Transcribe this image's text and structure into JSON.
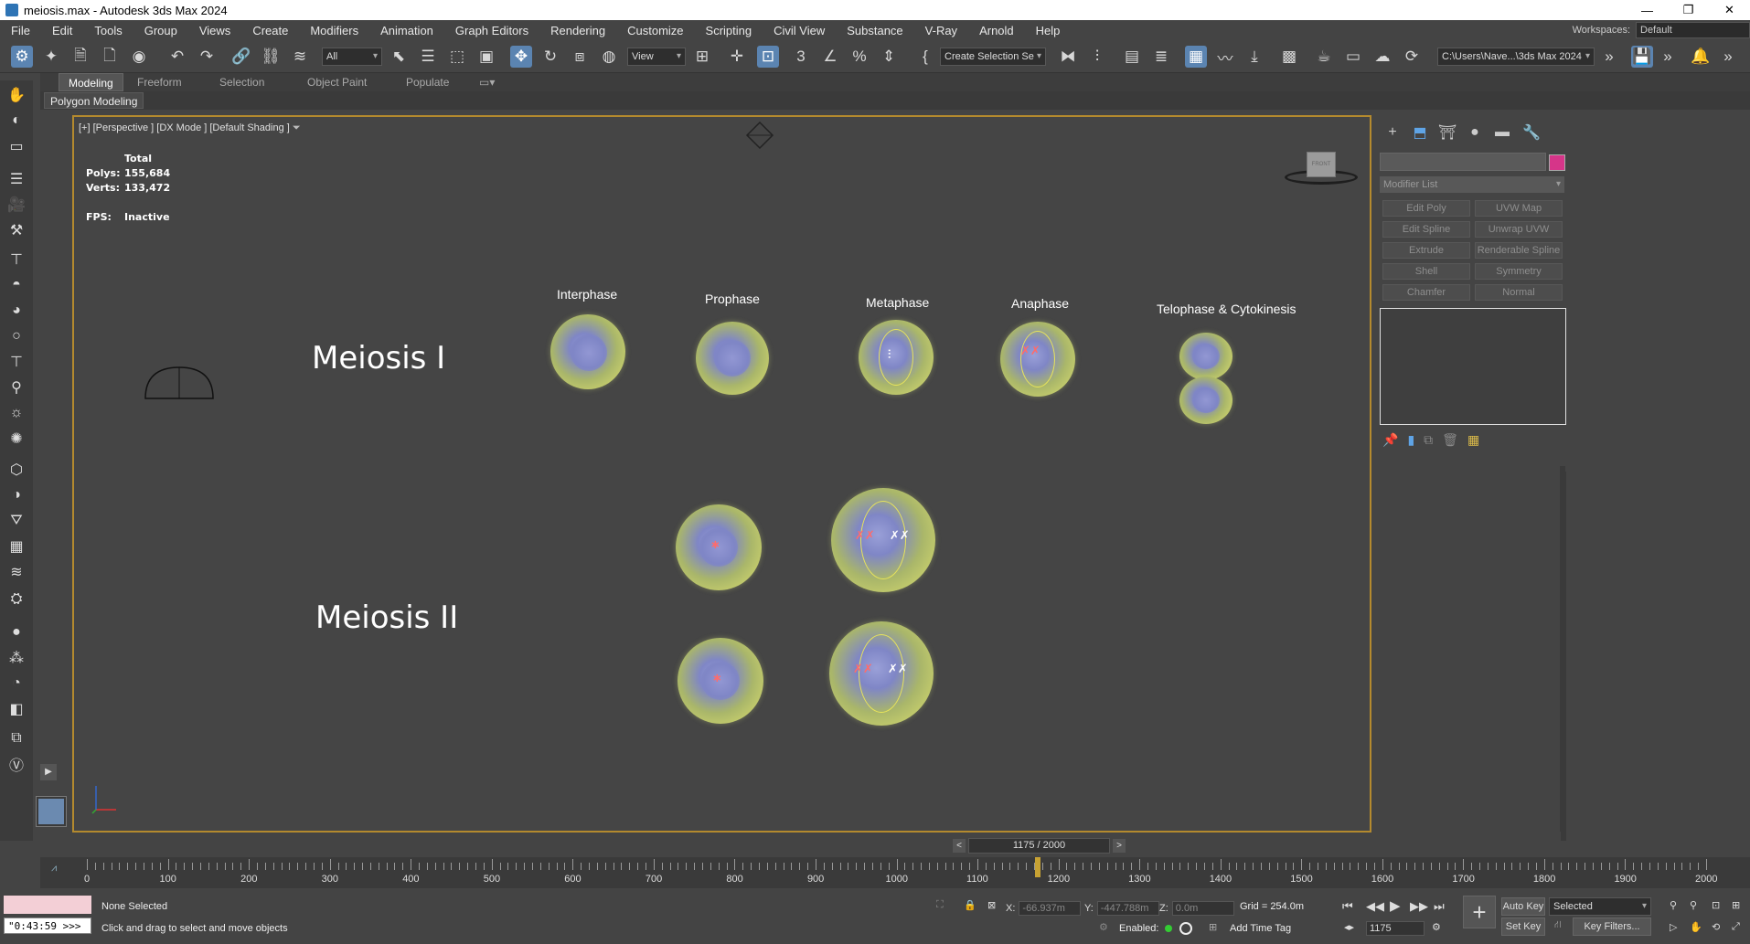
{
  "window": {
    "title": "meiosis.max - Autodesk 3ds Max 2024",
    "controls": [
      "—",
      "❐",
      "✕"
    ]
  },
  "menu": {
    "items": [
      "File",
      "Edit",
      "Tools",
      "Group",
      "Views",
      "Create",
      "Modifiers",
      "Animation",
      "Graph Editors",
      "Rendering",
      "Customize",
      "Scripting",
      "Civil View",
      "Substance",
      "V-Ray",
      "Arnold",
      "Help"
    ],
    "workspaces_label": "Workspaces:",
    "workspace_value": "Default"
  },
  "toolbar": {
    "filter_value": "All",
    "view_value": "View",
    "selection_set_value": "Create Selection Se",
    "path_value": "C:\\Users\\Nave...\\3ds Max 2024"
  },
  "ribbon": {
    "tabs": [
      "Modeling",
      "Freeform",
      "Selection",
      "Object Paint",
      "Populate"
    ],
    "active_tab": "Modeling",
    "panel_label": "Polygon Modeling"
  },
  "viewport": {
    "label": "[+] [Perspective ] [DX Mode ] [Default Shading ]",
    "stats": {
      "total_label": "Total",
      "polys_label": "Polys:",
      "polys_value": "155,684",
      "verts_label": "Verts:",
      "verts_value": "133,472",
      "fps_label": "FPS:",
      "fps_value": "Inactive"
    },
    "viewcube_label": "FRONT",
    "meiosis1_label": "Meiosis I",
    "meiosis2_label": "Meiosis II",
    "phases": [
      "Interphase",
      "Prophase",
      "Metaphase",
      "Anaphase",
      "Telophase & Cytokinesis"
    ]
  },
  "command_panel": {
    "modifier_list": "Modifier List",
    "buttons": [
      "Edit Poly",
      "UVW Map",
      "Edit Spline",
      "Unwrap UVW",
      "Extrude",
      "Renderable Spline",
      "Shell",
      "Symmetry",
      "Chamfer",
      "Normal"
    ],
    "color_swatch": "#d63589"
  },
  "timeslider": {
    "value": "1175 / 2000",
    "prev": "<",
    "next": ">"
  },
  "timeline": {
    "ticks": [
      "0",
      "100",
      "200",
      "300",
      "400",
      "500",
      "600",
      "700",
      "800",
      "900",
      "1000",
      "1100",
      "1200",
      "1300",
      "1400",
      "1500",
      "1600",
      "1700",
      "1800",
      "1900",
      "2000"
    ],
    "current_frame": 1175,
    "max_frame": 2000
  },
  "status": {
    "selection": "None Selected",
    "prompt": "Click and drag to select and move objects",
    "clock": "\"0:43:59 >>>",
    "x_label": "X:",
    "x_value": "-66.937m",
    "y_label": "Y:",
    "y_value": "-447.788m",
    "z_label": "Z:",
    "z_value": "0.0m",
    "grid": "Grid = 254.0m",
    "enabled_label": "Enabled:",
    "add_time_tag": "Add Time Tag",
    "frame_value": "1175",
    "auto_key": "Auto Key",
    "set_key": "Set Key",
    "selected_value": "Selected",
    "key_filters": "Key Filters..."
  }
}
